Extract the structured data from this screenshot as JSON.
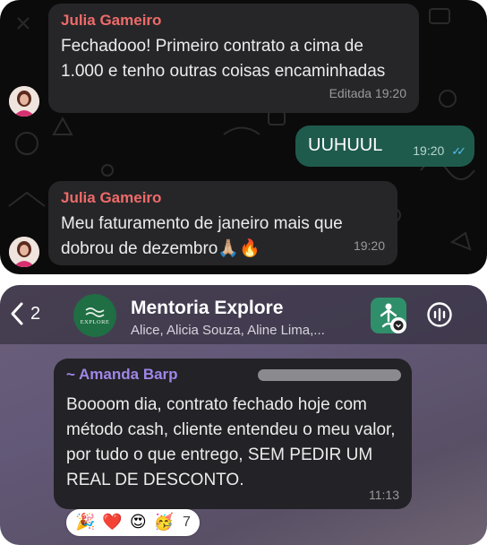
{
  "chat1": {
    "messages": [
      {
        "sender": "Julia Gameiro",
        "text": "Fechadooo! Primeiro contrato a cima de 1.000 e tenho outras coisas encaminhadas",
        "meta": "Editada 19:20"
      },
      {
        "text": "UUHUUL",
        "time": "19:20",
        "status_icon": "double-check-read-icon"
      },
      {
        "sender": "Julia Gameiro",
        "text": "Meu faturamento de janeiro mais que dobrou de dezembro🙏🏼🔥",
        "time": "19:20"
      }
    ]
  },
  "chat2": {
    "header": {
      "back_count": "2",
      "group_name": "Mentoria Explore",
      "members": "Alice, Alicia Souza, Aline Lima,...",
      "avatar_text": "EXPLORE"
    },
    "message": {
      "sender": "~ Amanda Barp",
      "text": "Boooom dia, contrato fechado hoje com método cash, cliente entendeu o meu valor, por tudo o que entrego, SEM PEDIR UM REAL DE DESCONTO.",
      "time": "11:13"
    },
    "reactions": {
      "emojis": [
        "🎉",
        "❤️",
        "😍",
        "🥳"
      ],
      "count": "7"
    }
  },
  "colors": {
    "dark_bg": "#0b0b0b",
    "incoming_bubble": "#262628",
    "outgoing_bubble": "#1f5b4d",
    "sender_red": "#ef6a6a",
    "sender_purple": "#9f86e8",
    "read_tick": "#53bdeb",
    "group_avatar": "#1f6e44"
  }
}
